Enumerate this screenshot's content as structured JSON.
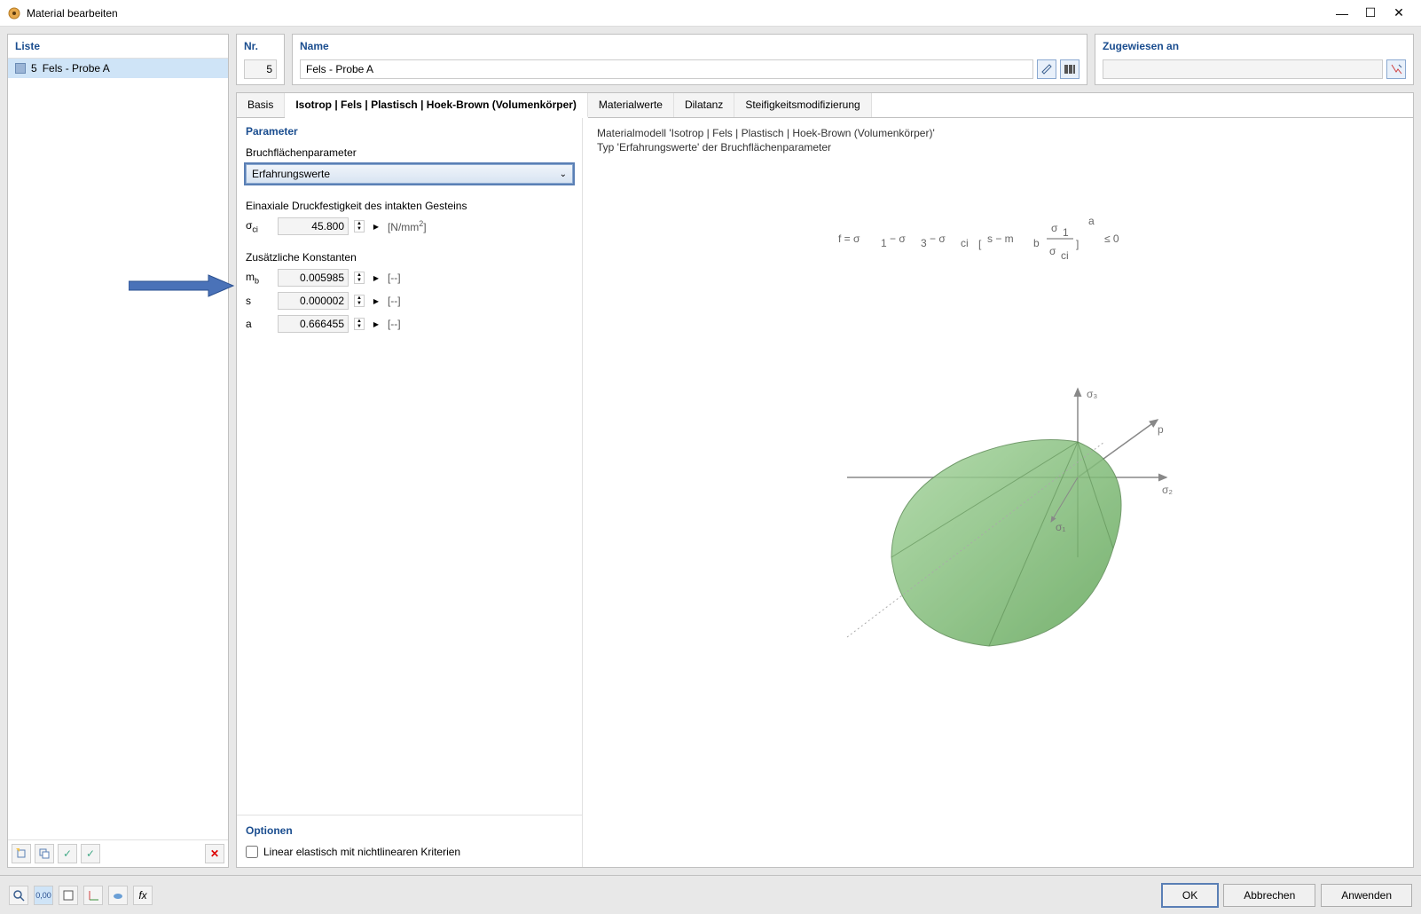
{
  "window": {
    "title": "Material bearbeiten"
  },
  "left": {
    "header": "Liste",
    "items": [
      {
        "num": "5",
        "name": "Fels - Probe A"
      }
    ]
  },
  "top": {
    "nr_label": "Nr.",
    "nr_value": "5",
    "name_label": "Name",
    "name_value": "Fels - Probe A",
    "assign_label": "Zugewiesen an",
    "assign_value": ""
  },
  "tabs": {
    "t0": "Basis",
    "t1": "Isotrop | Fels | Plastisch | Hoek-Brown (Volumenkörper)",
    "t2": "Materialwerte",
    "t3": "Dilatanz",
    "t4": "Steifigkeitsmodifizierung"
  },
  "params": {
    "section_title": "Parameter",
    "bfp_label": "Bruchflächenparameter",
    "bfp_value": "Erfahrungswerte",
    "uniax_label": "Einaxiale Druckfestigkeit des intakten Gesteins",
    "sigma_ci_sym": "σci",
    "sigma_ci_val": "45.800",
    "sigma_ci_unit": "[N/mm²]",
    "const_label": "Zusätzliche Konstanten",
    "mb_sym": "mb",
    "mb_val": "0.005985",
    "s_sym": "s",
    "s_val": "0.000002",
    "a_sym": "a",
    "a_val": "0.666455",
    "dimless_unit": "[--]"
  },
  "options": {
    "title": "Optionen",
    "linear": "Linear elastisch mit nichtlinearen Kriterien"
  },
  "info": {
    "line1": "Materialmodell 'Isotrop | Fels | Plastisch | Hoek-Brown (Volumenkörper)'",
    "line2": "Typ 'Erfahrungswerte' der Bruchflächenparameter"
  },
  "buttons": {
    "ok": "OK",
    "cancel": "Abbrechen",
    "apply": "Anwenden"
  }
}
